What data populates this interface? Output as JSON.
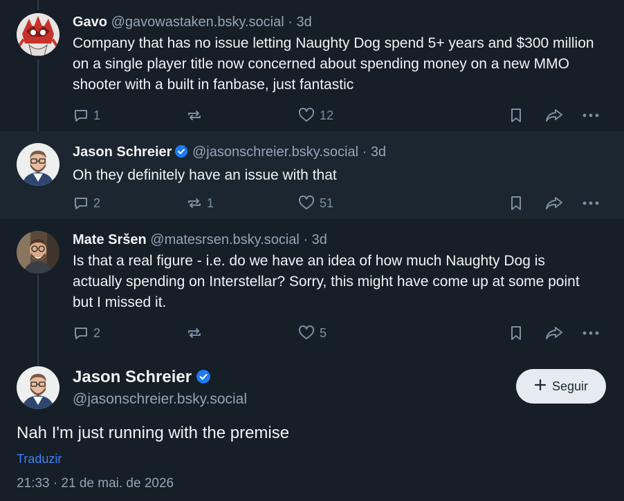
{
  "replies": [
    {
      "name": "Gavo",
      "handle": "@gavowastaken.bsky.social",
      "dot": "·",
      "time": "3d",
      "verified": false,
      "text": "Company that has no issue letting Naughty Dog spend 5+ years and $300 million on a single player title now concerned about spending money on a new MMO shooter with a built in fanbase, just fantastic",
      "reply_count": "1",
      "repost_count": "",
      "like_count": "12"
    },
    {
      "name": "Jason Schreier",
      "handle": "@jasonschreier.bsky.social",
      "dot": "·",
      "time": "3d",
      "verified": true,
      "text": "Oh they definitely have an issue with that",
      "reply_count": "2",
      "repost_count": "1",
      "like_count": "51"
    },
    {
      "name": "Mate Sršen",
      "handle": "@matesrsen.bsky.social",
      "dot": "·",
      "time": "3d",
      "verified": false,
      "text": "Is that a real figure - i.e. do we have an idea of how much Naughty Dog is actually spending on Interstellar? Sorry, this might have come up at some point but I missed it.",
      "reply_count": "2",
      "repost_count": "",
      "like_count": "5"
    }
  ],
  "main_post": {
    "name": "Jason Schreier",
    "handle": "@jasonschreier.bsky.social",
    "follow_label": "Seguir",
    "text": "Nah I'm just running with the premise",
    "translate_label": "Traduzir",
    "timestamp": "21:33 · 21 de mai. de 2026"
  },
  "colors": {
    "background": "#161e27",
    "highlight_row": "#1c2631",
    "muted_text": "#93a5b7",
    "icon": "#7b8fa3",
    "link": "#3b82f6",
    "verified": "#1d7bf5"
  },
  "icons": [
    "reply-icon",
    "repost-icon",
    "like-icon",
    "bookmark-icon",
    "share-icon",
    "more-icon",
    "verified-icon",
    "plus-icon"
  ]
}
